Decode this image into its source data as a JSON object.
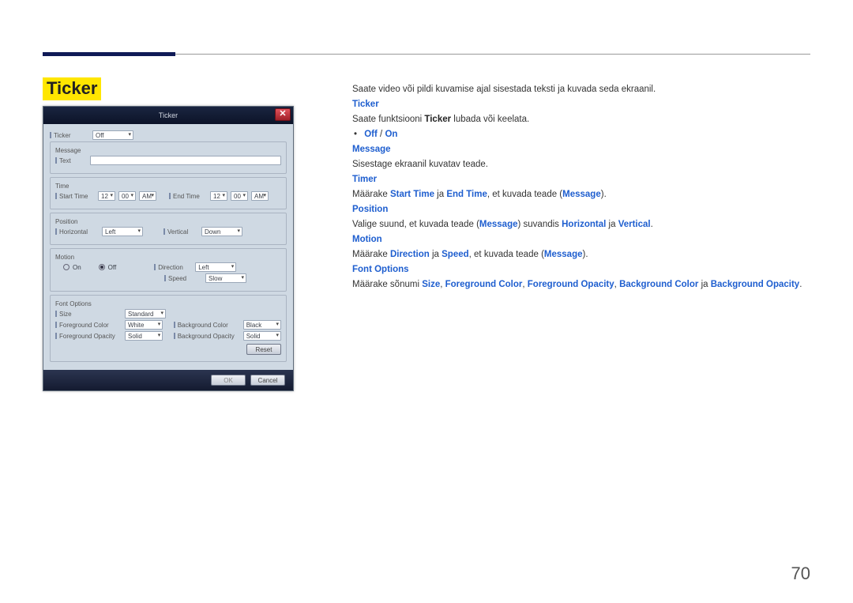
{
  "page_number": "70",
  "heading": "Ticker",
  "dialog": {
    "title": "Ticker",
    "close_x": "✕",
    "ticker_label": "Ticker",
    "ticker_value": "Off",
    "message_group": "Message",
    "text_label": "Text",
    "time_group": "Time",
    "start_time_label": "Start Time",
    "start_h": "12",
    "start_m": "00",
    "start_ampm": "AM",
    "end_time_label": "End Time",
    "end_h": "12",
    "end_m": "00",
    "end_ampm": "AM",
    "position_group": "Position",
    "horizontal_label": "Horizontal",
    "horizontal_value": "Left",
    "vertical_label": "Vertical",
    "vertical_value": "Down",
    "motion_group": "Motion",
    "on_label": "On",
    "off_label": "Off",
    "direction_label": "Direction",
    "direction_value": "Left",
    "speed_label": "Speed",
    "speed_value": "Slow",
    "font_options_group": "Font Options",
    "size_label": "Size",
    "size_value": "Standard",
    "fg_color_label": "Foreground Color",
    "fg_color_value": "White",
    "bg_color_label": "Background Color",
    "bg_color_value": "Black",
    "fg_opacity_label": "Foreground Opacity",
    "fg_opacity_value": "Solid",
    "bg_opacity_label": "Background Opacity",
    "bg_opacity_value": "Solid",
    "reset_btn": "Reset",
    "ok_btn": "OK",
    "cancel_btn": "Cancel"
  },
  "body": {
    "intro": "Saate video või pildi kuvamise ajal sisestada teksti ja kuvada seda ekraanil.",
    "ticker_heading": "Ticker",
    "ticker_p_a": "Saate funktsiooni ",
    "ticker_p_b": "Ticker",
    "ticker_p_c": " lubada või keelata.",
    "off_on_a": "Off",
    "off_on_sep": " / ",
    "off_on_b": "On",
    "message_heading": "Message",
    "message_p": "Sisestage ekraanil kuvatav teade.",
    "timer_heading": "Timer",
    "timer_a": "Määrake ",
    "timer_b": "Start Time",
    "timer_c": " ja ",
    "timer_d": "End Time",
    "timer_e": ", et kuvada teade (",
    "timer_f": "Message",
    "timer_g": ").",
    "position_heading": "Position",
    "position_a": "Valige suund, et kuvada teade (",
    "position_b": "Message",
    "position_c": ") suvandis ",
    "position_d": "Horizontal",
    "position_e": " ja ",
    "position_f": "Vertical",
    "position_g": ".",
    "motion_heading": "Motion",
    "motion_a": "Määrake ",
    "motion_b": "Direction",
    "motion_c": " ja ",
    "motion_d": "Speed",
    "motion_e": ", et kuvada teade (",
    "motion_f": "Message",
    "motion_g": ").",
    "fontopts_heading": "Font Options",
    "fontopts_a": "Määrake sõnumi ",
    "fontopts_b": "Size",
    "fontopts_c": ", ",
    "fontopts_d": "Foreground Color",
    "fontopts_e": ", ",
    "fontopts_f": "Foreground Opacity",
    "fontopts_g": ", ",
    "fontopts_h": "Background Color",
    "fontopts_i": " ja ",
    "fontopts_j": "Background Opacity",
    "fontopts_k": "."
  }
}
